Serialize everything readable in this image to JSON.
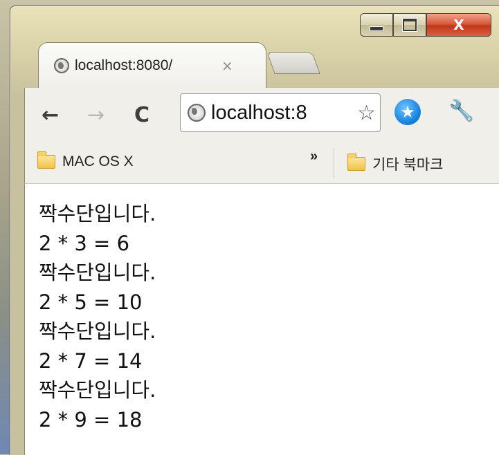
{
  "window": {
    "minimize_icon": "minimize-icon",
    "maximize_icon": "maximize-icon",
    "close_label": "X"
  },
  "tab": {
    "favicon": "globe-icon",
    "title": "localhost:8080/",
    "close_label": "×"
  },
  "toolbar": {
    "back_label": "←",
    "forward_label": "→",
    "reload_label": "C",
    "url": "localhost:8",
    "star_label": "☆",
    "extension_icon": "star-badge-icon",
    "wrench_label": "🔧"
  },
  "bookmarks": {
    "items": [
      {
        "label": "MAC OS X",
        "icon": "folder-icon"
      }
    ],
    "overflow_label": "»",
    "other_bookmarks": {
      "label": "기타 북마크",
      "icon": "folder-icon"
    }
  },
  "content": {
    "lines": [
      "짝수단입니다.",
      "2 * 3 = 6",
      "짝수단입니다.",
      "2 * 5 = 10",
      "짝수단입니다.",
      "2 * 7 = 14",
      "짝수단입니다.",
      "2 * 9 = 18"
    ]
  },
  "colors": {
    "close_button": "#c2371a",
    "extension_blue": "#1b87e0",
    "folder_yellow": "#f0c24a"
  }
}
